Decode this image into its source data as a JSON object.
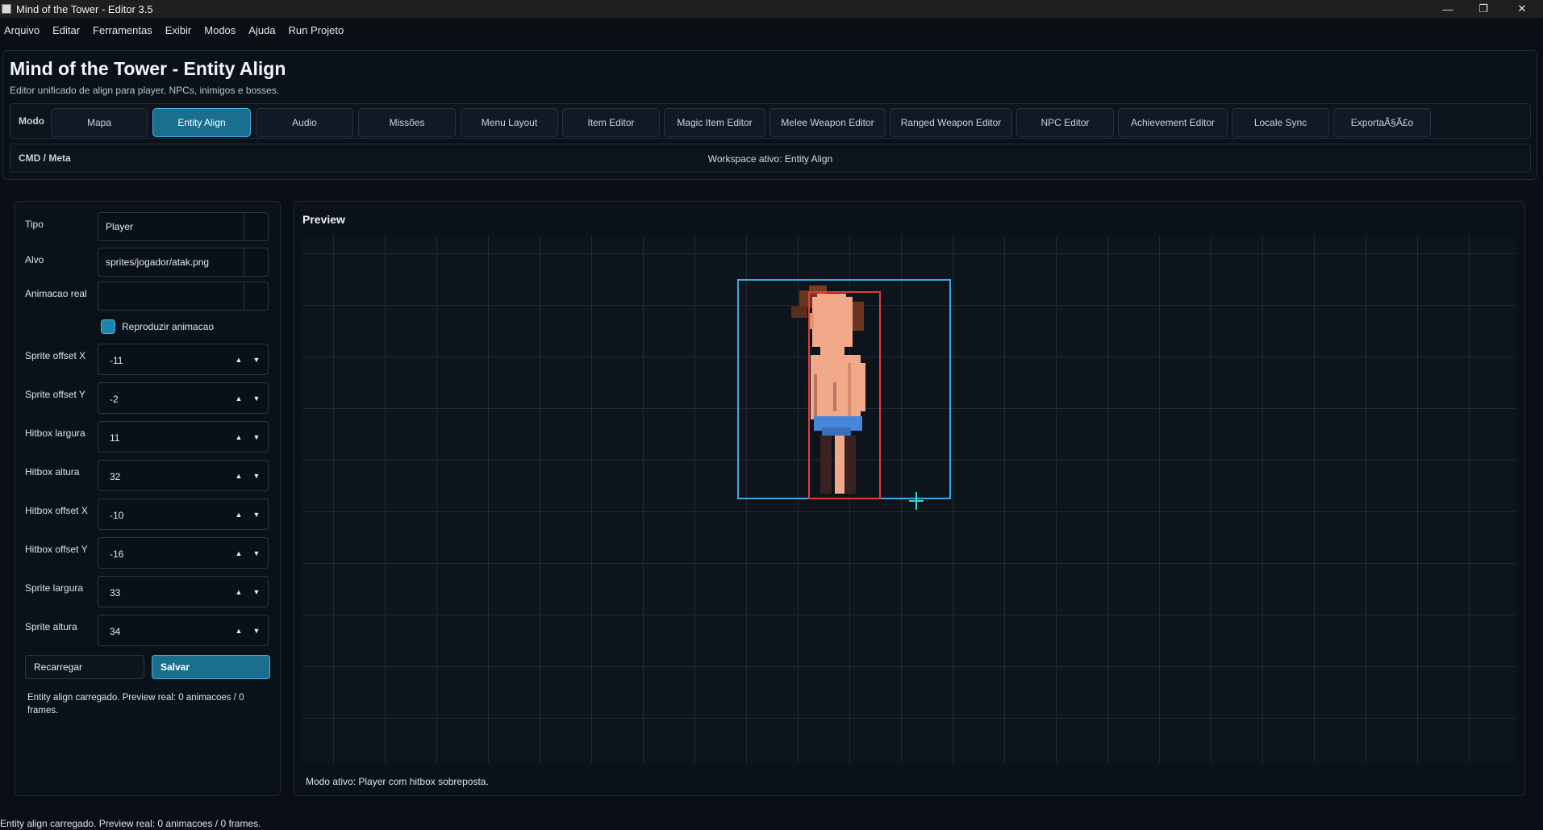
{
  "window": {
    "title": "Mind of the Tower - Editor 3.5"
  },
  "menubar": [
    "Arquivo",
    "Editar",
    "Ferramentas",
    "Exibir",
    "Modos",
    "Ajuda",
    "Run Projeto"
  ],
  "header": {
    "title": "Mind of the Tower - Entity Align",
    "subtitle": "Editor unificado de align para player, NPCs, inimigos e bosses."
  },
  "modes": {
    "label": "Modo",
    "tabs": [
      "Mapa",
      "Entity Align",
      "Audio",
      "Missões",
      "Menu Layout",
      "Item Editor",
      "Magic Item Editor",
      "Melee Weapon Editor",
      "Ranged Weapon Editor",
      "NPC Editor",
      "Achievement Editor",
      "Locale Sync",
      "ExportaÃ§Ã£o"
    ],
    "active": "Entity Align"
  },
  "cmd": {
    "label": "CMD / Meta",
    "workspace": "Workspace ativo: Entity Align"
  },
  "form": {
    "tipo_label": "Tipo",
    "tipo_value": "Player",
    "alvo_label": "Alvo",
    "alvo_value": "sprites/jogador/atak.png",
    "animacao_label": "Animacao real",
    "animacao_value": "",
    "reproduzir_label": "Reproduzir animacao",
    "reproduzir_checked": true,
    "spinners": [
      {
        "label": "Sprite offset X",
        "value": "-11"
      },
      {
        "label": "Sprite offset Y",
        "value": "-2"
      },
      {
        "label": "Hitbox largura",
        "value": "11"
      },
      {
        "label": "Hitbox altura",
        "value": "32"
      },
      {
        "label": "Hitbox offset X",
        "value": "-10"
      },
      {
        "label": "Hitbox offset Y",
        "value": "-16"
      },
      {
        "label": "Sprite largura",
        "value": "33"
      },
      {
        "label": "Sprite altura",
        "value": "34"
      }
    ],
    "reload_label": "Recarregar",
    "save_label": "Salvar",
    "status": "Entity align carregado. Preview real: 0 animacoes / 0 frames."
  },
  "preview": {
    "title": "Preview",
    "status": "Modo ativo: Player com hitbox sobreposta.",
    "colors": {
      "sprite_box": "#3da8e6",
      "hitbox": "#e23b3b",
      "anchor": "#3ad9d0"
    }
  },
  "statusbar": "Entity align carregado. Preview real: 0 animacoes / 0 frames."
}
